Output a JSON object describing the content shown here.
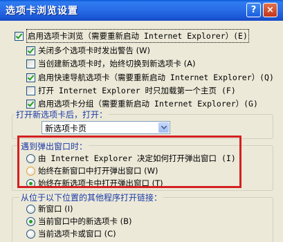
{
  "window": {
    "title": "选项卡浏览设置",
    "help_label": "?",
    "close_label": "×"
  },
  "enable_tabs": {
    "label": "启用选项卡浏览（需要重新启动 Internet Explorer）(E)",
    "checked": true
  },
  "options": [
    {
      "label": "关闭多个选项卡时发出警告 (W)",
      "checked": true
    },
    {
      "label": "当创建新选项卡时，始终切换到新选项卡 (A)",
      "checked": false
    },
    {
      "label": "启用快速导航选项卡（需要重新启动 Internet Explorer）(Q)",
      "checked": true
    },
    {
      "label": "打开 Internet Explorer 时只加载第一个主页 (F)",
      "checked": false
    },
    {
      "label": "启用选项卡分组（需要重新启动 Internet Explorer）(G)",
      "checked": true
    }
  ],
  "new_tab": {
    "title": "打开新选项卡后，打开：",
    "selected": "新选项卡页"
  },
  "popup": {
    "title": "遇到弹出窗口时：",
    "options": [
      {
        "label": "由 Internet Explorer 决定如何打开弹出窗口 (I)",
        "selected": false
      },
      {
        "label": "始终在新窗口中打开弹出窗口 (W)",
        "selected": false
      },
      {
        "label": "始终在新选项卡中打开弹出窗口 (T)",
        "selected": true
      }
    ]
  },
  "external": {
    "title": "从位于以下位置的其他程序打开链接：",
    "options": [
      {
        "label": "新窗口 (I)",
        "selected": false
      },
      {
        "label": "当前窗口中的新选项卡 (B)",
        "selected": true
      },
      {
        "label": "当前选项卡或窗口 (C)",
        "selected": false
      }
    ]
  }
}
